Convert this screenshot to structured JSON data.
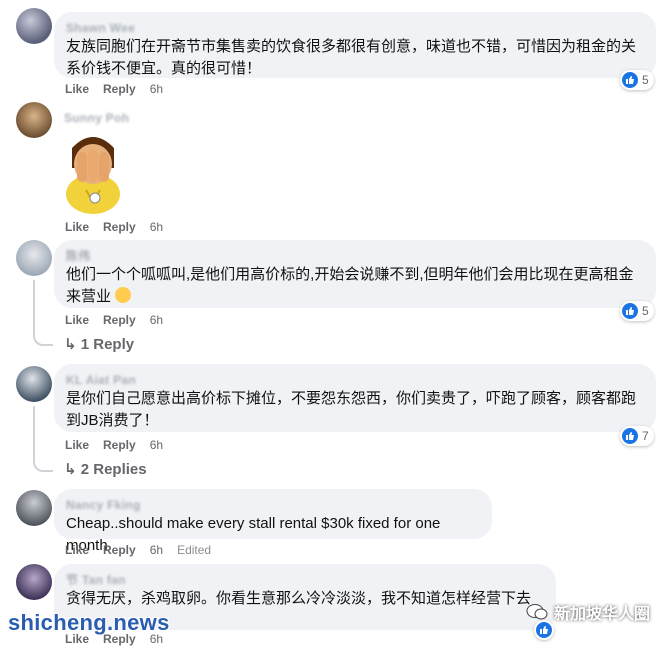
{
  "comments": [
    {
      "author": "Shawn Wee",
      "text": "友族同胞们在开斋节市集售卖的饮食很多都很有创意，味道也不错，可惜因为租金的关系价钱不便宜。真的很可惜！",
      "like": "Like",
      "reply": "Reply",
      "time": "6h",
      "reactions": "5"
    },
    {
      "author": "Sunny Poh",
      "like": "Like",
      "reply": "Reply",
      "time": "6h"
    },
    {
      "author": "陈伟",
      "text": "他们一个个呱呱叫,是他们用高价标的,开始会说赚不到,但明年他们会用比现在更高租金来营业",
      "like": "Like",
      "reply": "Reply",
      "time": "6h",
      "reactions": "5",
      "replies": "1 Reply"
    },
    {
      "author": "KL Aiat Pan",
      "text": "是你们自己愿意出高价标下摊位，不要怨东怨西，你们卖贵了，吓跑了顾客，顾客都跑到JB消费了！",
      "like": "Like",
      "reply": "Reply",
      "time": "6h",
      "reactions": "7",
      "replies": "2 Replies"
    },
    {
      "author": "Nancy Fking",
      "text": "Cheap..should make every stall rental $30k fixed for one month",
      "like": "Like",
      "reply": "Reply",
      "time": "6h",
      "edited": "Edited"
    },
    {
      "author": "节 Tan fan",
      "text": "贪得无厌，杀鸡取卵。你看生意那么冷冷淡淡，我不知道怎样经营下去",
      "like": "Like",
      "reply": "Reply",
      "time": "6h"
    }
  ],
  "watermark": "shicheng.news",
  "brand": "新加坡华人圈",
  "colors": {
    "accent": "#1b74e4",
    "bubble": "#f0f2f5",
    "meta": "#65676b"
  }
}
